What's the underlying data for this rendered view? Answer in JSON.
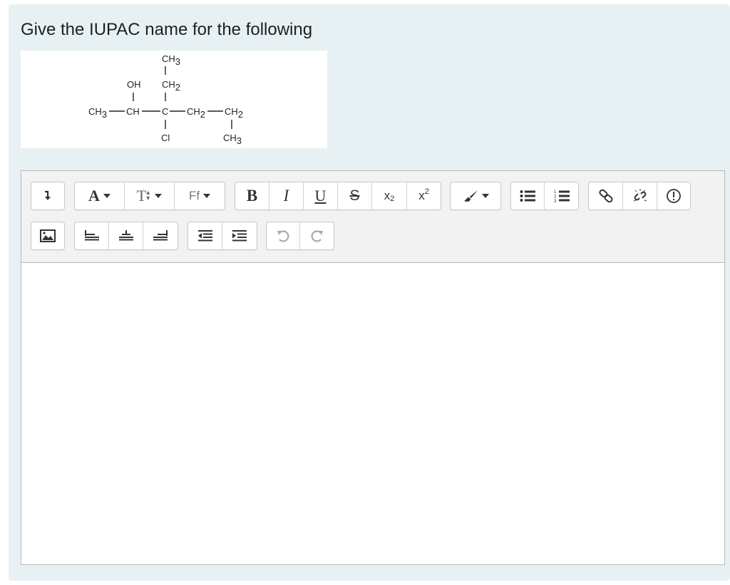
{
  "question": {
    "text": "Give the IUPAC name for the following"
  },
  "structure": {
    "ch3_top": "CH",
    "ch3_top_sub": "3",
    "oh": "OH",
    "ch2_upper": "CH",
    "ch2_upper_sub": "2",
    "ch3_left": "CH",
    "ch3_left_sub": "3",
    "ch": "CH",
    "c": "C",
    "ch2_mid": "CH",
    "ch2_mid_sub": "2",
    "ch2_right": "CH",
    "ch2_right_sub": "2",
    "cl": "Cl",
    "ch3_bottom": "CH",
    "ch3_bottom_sub": "3"
  },
  "toolbar": {
    "font_color_label": "A",
    "font_size_label": "T",
    "font_family_label": "Ff",
    "bold_label": "B",
    "italic_label": "I",
    "underline_label": "U",
    "strike_label": "S",
    "subscript_label": "x",
    "subscript_sub": "2",
    "superscript_label": "x",
    "superscript_sup": "2",
    "icons": {
      "collapse": "arrow-down-icon",
      "image": "image-icon",
      "align_left": "align-left-icon",
      "align_center": "align-center-icon",
      "align_right": "align-right-icon",
      "outdent": "outdent-icon",
      "indent": "indent-icon",
      "undo": "undo-icon",
      "redo": "redo-icon",
      "background_color": "paintbrush-icon",
      "unordered_list": "bullet-list-icon",
      "ordered_list": "numbered-list-icon",
      "link": "link-icon",
      "unlink": "unlink-icon",
      "accessibility": "warning-circle-icon"
    }
  },
  "editor": {
    "content": ""
  }
}
